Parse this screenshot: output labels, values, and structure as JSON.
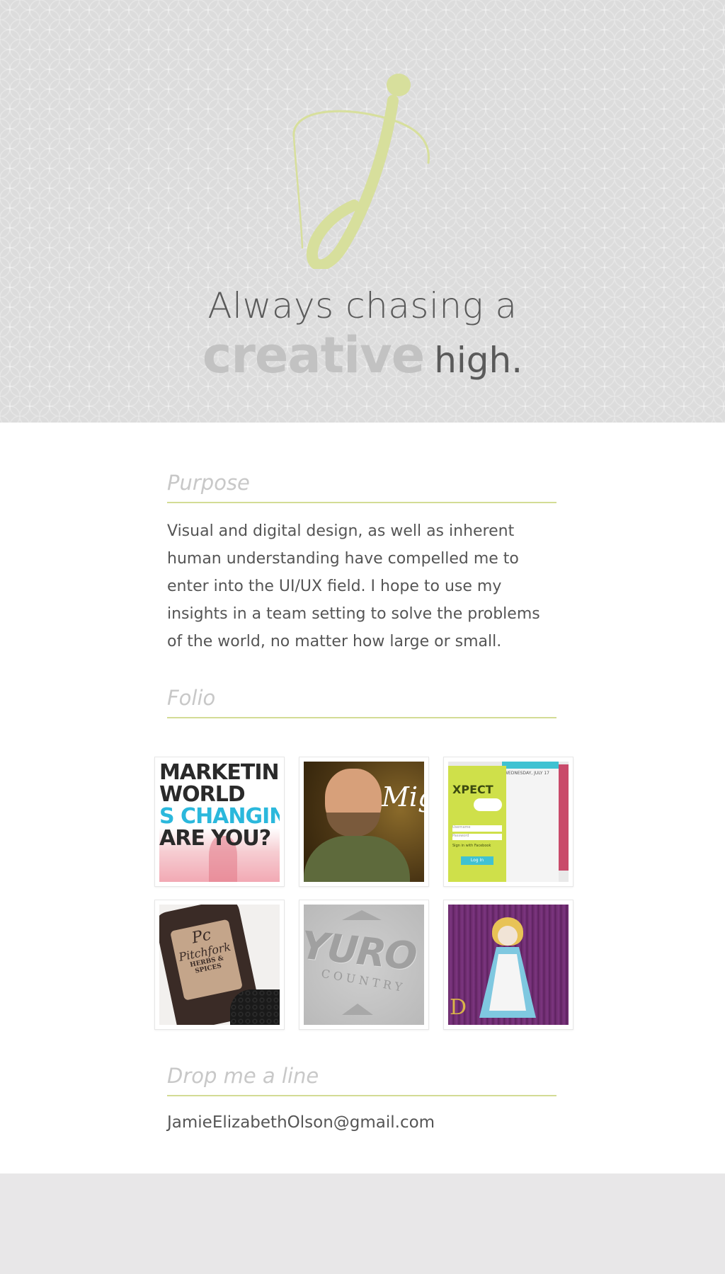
{
  "hero": {
    "tagline_line1": "Always chasing a",
    "tagline_emphasis": "creative",
    "tagline_rest": "high.",
    "logo_color": "#d7df9c"
  },
  "sections": {
    "purpose": {
      "title": "Purpose",
      "body": "Visual and digital design, as well as inherent human understanding have compelled me to enter into the UI/UX field. I hope to use my insights in a team setting to solve the problems of the world, no matter how large or small."
    },
    "folio": {
      "title": "Folio",
      "items": [
        {
          "lines": [
            "MARKETING",
            "WORLD",
            "S CHANGING",
            "ARE YOU?"
          ]
        },
        {
          "text": "Mig"
        },
        {
          "brand": "XPECT",
          "sub": "WEDNESDAY, JULY 17",
          "fields": [
            "Username",
            "Password"
          ],
          "button": "Log In",
          "link": "Sign in with Facebook"
        },
        {
          "brand": "Pc",
          "line1": "Pitchfork",
          "line2": "HERBS & SPICES"
        },
        {
          "brand": "YURO",
          "sub": "COUNTRY"
        },
        {
          "letter": "D"
        }
      ]
    },
    "contact": {
      "title": "Drop me a line",
      "email": "JamieElizabethOlson@gmail.com"
    }
  },
  "colors": {
    "accent": "#d3dc95",
    "hero_bg": "#dcdcdc",
    "footer_bg": "#e8e7e8"
  }
}
